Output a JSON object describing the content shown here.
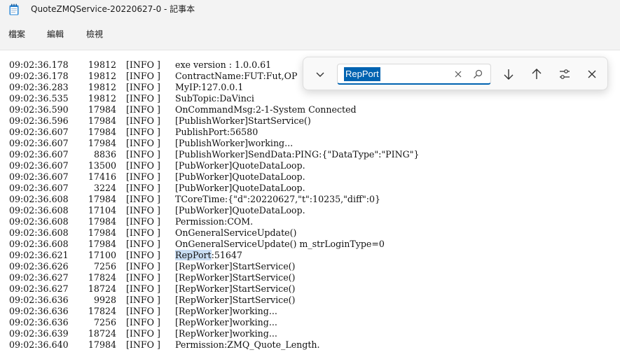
{
  "window": {
    "title": "QuoteZMQService-20220627-0 - 記事本"
  },
  "menu": {
    "file": "檔案",
    "edit": "編輯",
    "view": "檢視"
  },
  "find": {
    "query": "RepPort"
  },
  "colors": {
    "accent": "#0063b1",
    "highlight": "#c9ddf3"
  },
  "log": [
    {
      "time": "09:02:36.178",
      "tid": "19812",
      "level": "[INFO ]",
      "msg": "exe version : 1.0.0.61"
    },
    {
      "time": "09:02:36.178",
      "tid": "19812",
      "level": "[INFO ]",
      "msg": "ContractName:FUT:Fut,OP"
    },
    {
      "time": "09:02:36.283",
      "tid": "19812",
      "level": "[INFO ]",
      "msg": "MyIP:127.0.0.1"
    },
    {
      "time": "09:02:36.535",
      "tid": "19812",
      "level": "[INFO ]",
      "msg": "SubTopic:DaVinci"
    },
    {
      "time": "09:02:36.590",
      "tid": "17984",
      "level": "[INFO ]",
      "msg": "OnCommandMsg:2-1-System Connected"
    },
    {
      "time": "09:02:36.596",
      "tid": "17984",
      "level": "[INFO ]",
      "msg": "[PublishWorker]StartService()"
    },
    {
      "time": "09:02:36.607",
      "tid": "17984",
      "level": "[INFO ]",
      "msg": "PublishPort:56580"
    },
    {
      "time": "09:02:36.607",
      "tid": "17984",
      "level": "[INFO ]",
      "msg": "[PublishWorker]working..."
    },
    {
      "time": "09:02:36.607",
      "tid": "8836",
      "level": "[INFO ]",
      "msg": "[PublishWorker]SendData:PING:{\"DataType\":\"PING\"}"
    },
    {
      "time": "09:02:36.607",
      "tid": "13500",
      "level": "[INFO ]",
      "msg": "[PubWorker]QuoteDataLoop."
    },
    {
      "time": "09:02:36.607",
      "tid": "17416",
      "level": "[INFO ]",
      "msg": "[PubWorker]QuoteDataLoop."
    },
    {
      "time": "09:02:36.607",
      "tid": "3224",
      "level": "[INFO ]",
      "msg": "[PubWorker]QuoteDataLoop."
    },
    {
      "time": "09:02:36.608",
      "tid": "17984",
      "level": "[INFO ]",
      "msg": "TCoreTime:{\"d\":20220627,\"t\":10235,\"diff\":0}"
    },
    {
      "time": "09:02:36.608",
      "tid": "17104",
      "level": "[INFO ]",
      "msg": "[PubWorker]QuoteDataLoop."
    },
    {
      "time": "09:02:36.608",
      "tid": "17984",
      "level": "[INFO ]",
      "msg": "Permission:COM."
    },
    {
      "time": "09:02:36.608",
      "tid": "17984",
      "level": "[INFO ]",
      "msg": "OnGeneralServiceUpdate()"
    },
    {
      "time": "09:02:36.608",
      "tid": "17984",
      "level": "[INFO ]",
      "msg": "OnGeneralServiceUpdate() m_strLoginType=0"
    },
    {
      "time": "09:02:36.621",
      "tid": "17100",
      "level": "[INFO ]",
      "msg_hl": "RepPort",
      "msg": ":51647"
    },
    {
      "time": "09:02:36.626",
      "tid": "7256",
      "level": "[INFO ]",
      "msg": "[RepWorker]StartService()"
    },
    {
      "time": "09:02:36.627",
      "tid": "17824",
      "level": "[INFO ]",
      "msg": "[RepWorker]StartService()"
    },
    {
      "time": "09:02:36.627",
      "tid": "18724",
      "level": "[INFO ]",
      "msg": "[RepWorker]StartService()"
    },
    {
      "time": "09:02:36.636",
      "tid": "9928",
      "level": "[INFO ]",
      "msg": "[RepWorker]StartService()"
    },
    {
      "time": "09:02:36.636",
      "tid": "17824",
      "level": "[INFO ]",
      "msg": "[RepWorker]working..."
    },
    {
      "time": "09:02:36.636",
      "tid": "7256",
      "level": "[INFO ]",
      "msg": "[RepWorker]working..."
    },
    {
      "time": "09:02:36.639",
      "tid": "18724",
      "level": "[INFO ]",
      "msg": "[RepWorker]working..."
    },
    {
      "time": "09:02:36.640",
      "tid": "17984",
      "level": "[INFO ]",
      "msg": "Permission:ZMQ_Quote_Length."
    }
  ]
}
